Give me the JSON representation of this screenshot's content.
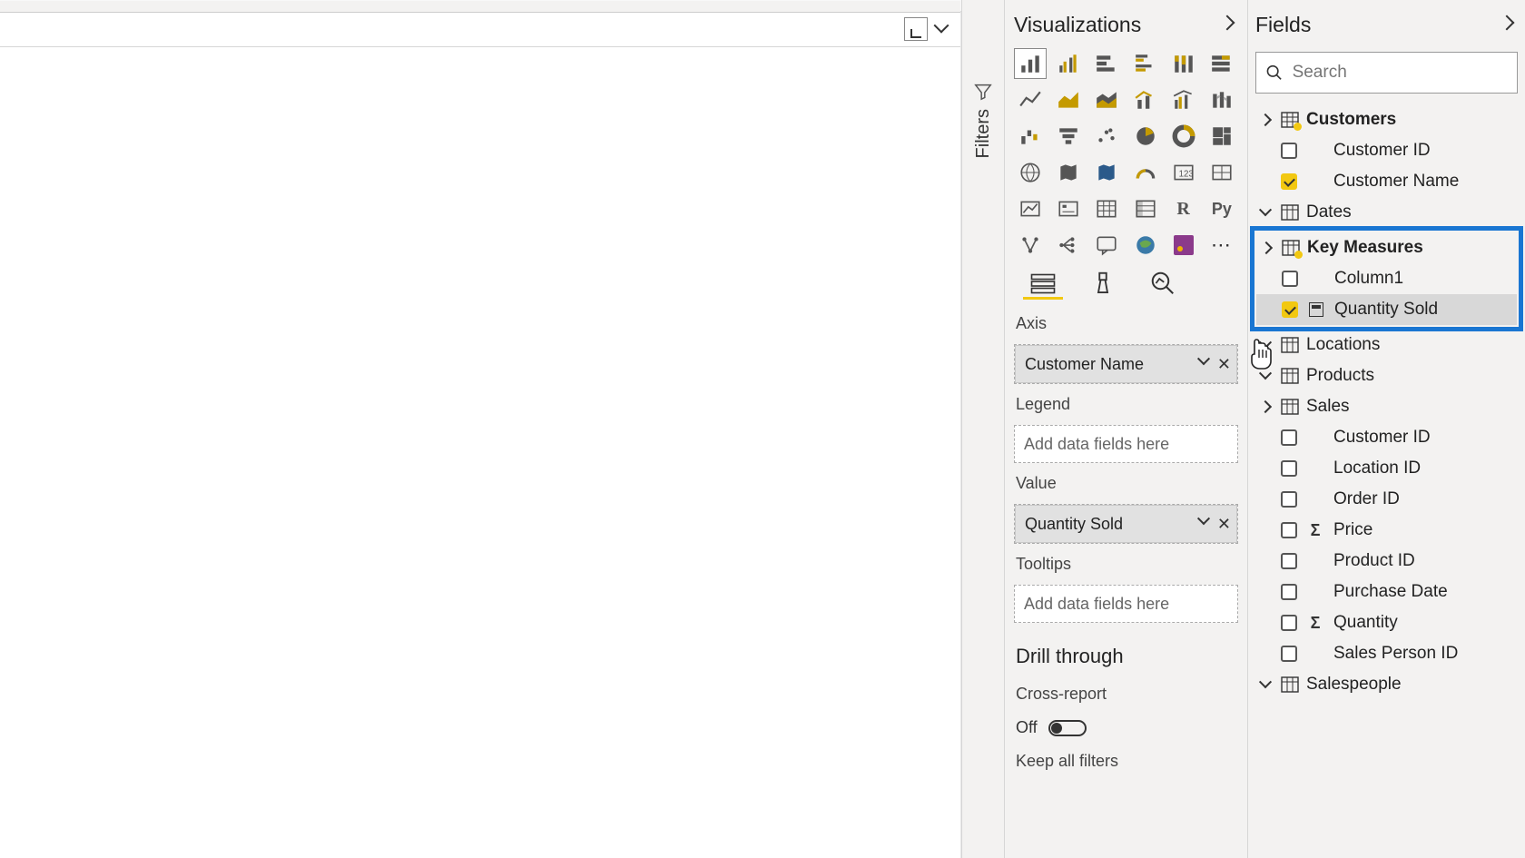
{
  "panes": {
    "visualizations_title": "Visualizations",
    "fields_title": "Fields",
    "filters_label": "Filters"
  },
  "search": {
    "placeholder": "Search"
  },
  "wells": {
    "axis_label": "Axis",
    "axis_field": "Customer Name",
    "legend_label": "Legend",
    "legend_placeholder": "Add data fields here",
    "value_label": "Value",
    "value_field": "Quantity Sold",
    "tooltips_label": "Tooltips",
    "tooltips_placeholder": "Add data fields here"
  },
  "drill": {
    "title": "Drill through",
    "cross_report_label": "Cross-report",
    "cross_report_state": "Off",
    "keep_filters_label": "Keep all filters"
  },
  "tables": {
    "customers": {
      "name": "Customers",
      "fields": {
        "customer_id": "Customer ID",
        "customer_name": "Customer Name"
      }
    },
    "dates": {
      "name": "Dates"
    },
    "key_measures": {
      "name": "Key Measures",
      "fields": {
        "column1": "Column1",
        "quantity_sold": "Quantity Sold"
      }
    },
    "locations": {
      "name": "Locations"
    },
    "products": {
      "name": "Products"
    },
    "sales": {
      "name": "Sales",
      "fields": {
        "customer_id": "Customer ID",
        "location_id": "Location ID",
        "order_id": "Order ID",
        "price": "Price",
        "product_id": "Product ID",
        "purchase_date": "Purchase Date",
        "quantity": "Quantity",
        "sales_person_id": "Sales Person ID"
      }
    },
    "salespeople": {
      "name": "Salespeople"
    }
  }
}
